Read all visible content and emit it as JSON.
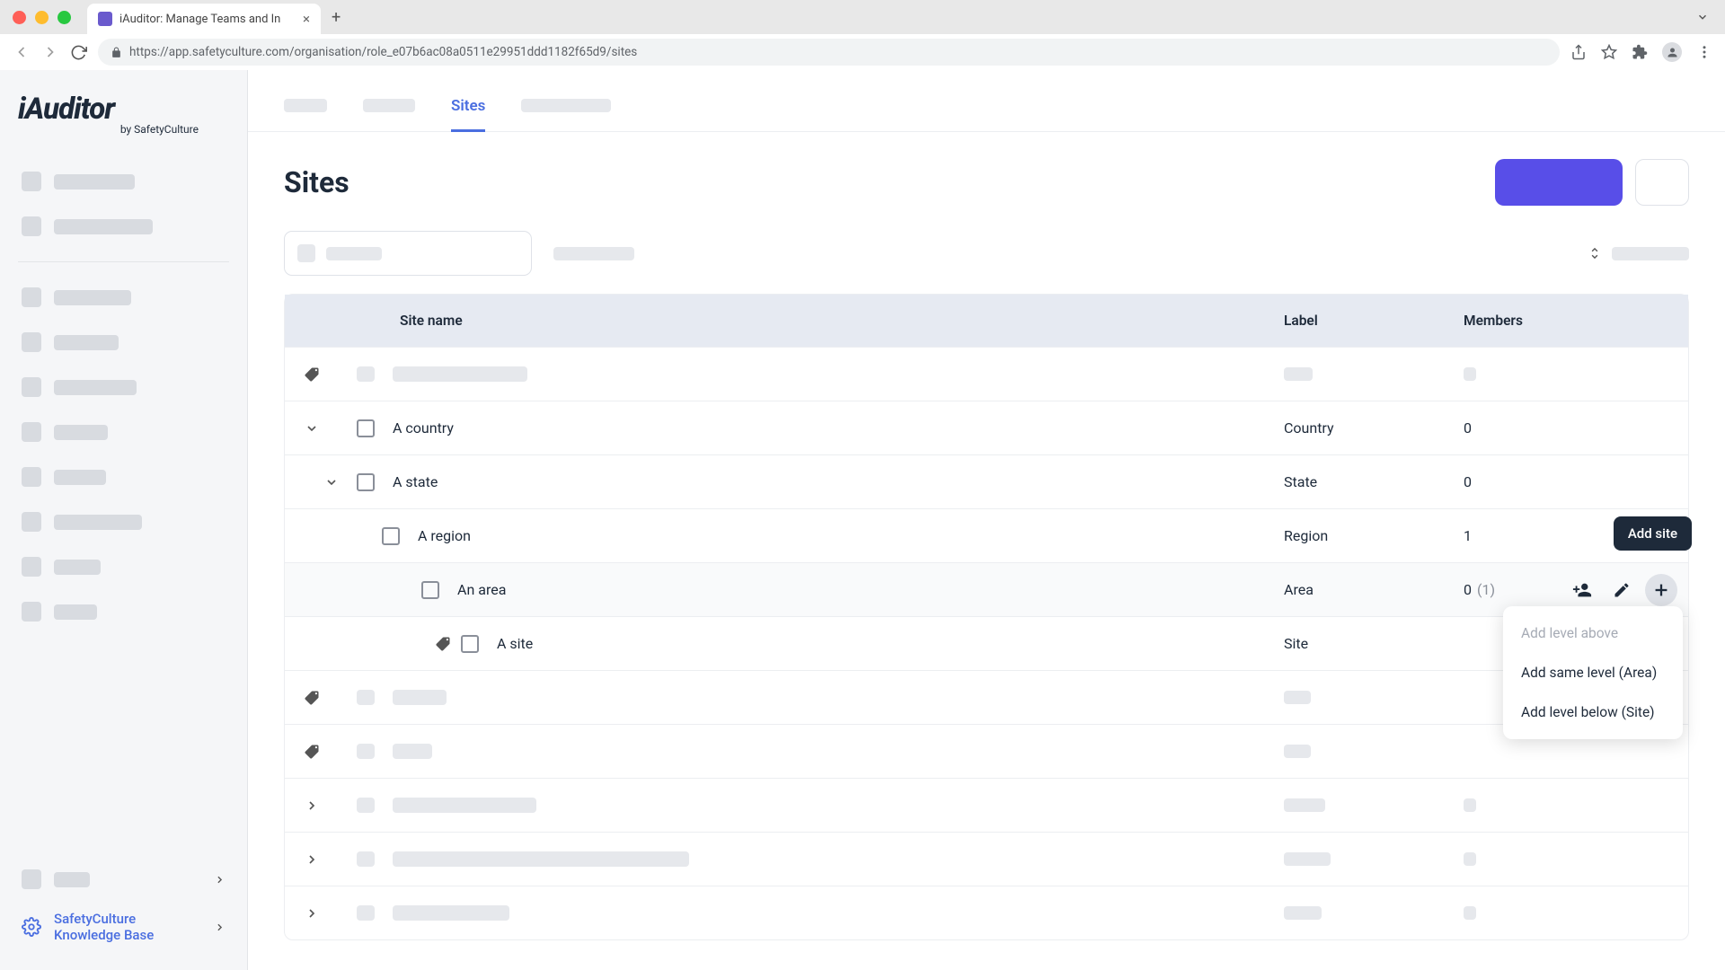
{
  "browser": {
    "tab_title": "iAuditor: Manage Teams and In",
    "url": "https://app.safetyculture.com/organisation/role_e07b6ac08a0511e29951ddd1182f65d9/sites"
  },
  "logo": {
    "main": "iAuditor",
    "sub": "by SafetyCulture"
  },
  "tabs": {
    "active": "Sites"
  },
  "page_title": "Sites",
  "table": {
    "headers": {
      "name": "Site name",
      "label": "Label",
      "members": "Members"
    },
    "rows": [
      {
        "name": "A country",
        "label": "Country",
        "members": "0"
      },
      {
        "name": "A state",
        "label": "State",
        "members": "0"
      },
      {
        "name": "A region",
        "label": "Region",
        "members": "1"
      },
      {
        "name": "An area",
        "label": "Area",
        "members": "0",
        "members_paren": "(1)"
      },
      {
        "name": "A site",
        "label": "Site",
        "members": ""
      }
    ]
  },
  "tooltip": {
    "add_site": "Add site"
  },
  "dropdown": {
    "add_above": "Add level above",
    "add_same": "Add same level (Area)",
    "add_below": "Add level below (Site)"
  },
  "sidebar_kb": {
    "line1": "SafetyCulture",
    "line2": "Knowledge Base"
  }
}
